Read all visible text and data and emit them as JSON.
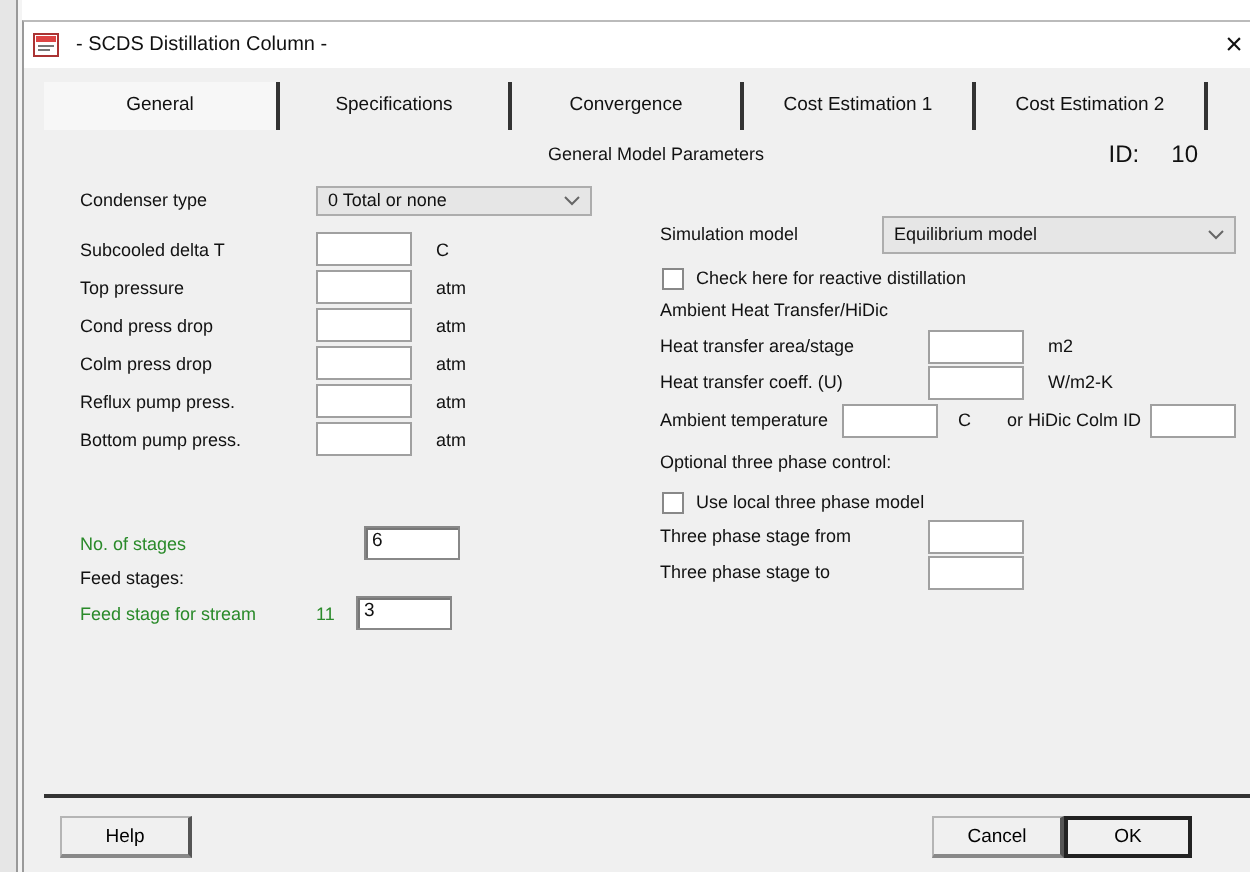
{
  "window": {
    "title": "- SCDS Distillation Column -",
    "close": "×"
  },
  "tabs": [
    {
      "label": "General",
      "selected": true
    },
    {
      "label": "Specifications",
      "selected": false
    },
    {
      "label": "Convergence",
      "selected": false
    },
    {
      "label": "Cost Estimation 1",
      "selected": false
    },
    {
      "label": "Cost Estimation 2",
      "selected": false
    }
  ],
  "panel": {
    "heading": "General Model Parameters",
    "id_label": "ID:",
    "id_value": "10"
  },
  "condenser": {
    "label": "Condenser type",
    "value": "0 Total or none"
  },
  "left_fields": [
    {
      "label": "Subcooled delta T",
      "unit": "C"
    },
    {
      "label": "Top pressure",
      "unit": "atm"
    },
    {
      "label": "Cond press drop",
      "unit": "atm"
    },
    {
      "label": "Colm press drop",
      "unit": "atm"
    },
    {
      "label": "Reflux pump press.",
      "unit": "atm"
    },
    {
      "label": "Bottom pump press.",
      "unit": "atm"
    }
  ],
  "stages": {
    "label": "No. of stages",
    "value": "6"
  },
  "feed": {
    "heading": "Feed stages:",
    "rows": [
      {
        "label": "Feed stage for stream",
        "stream": "11",
        "value": "3"
      }
    ]
  },
  "simulation_model": {
    "label": "Simulation model",
    "value": "Equilibrium model"
  },
  "reactive": {
    "label": "Check here for reactive distillation",
    "checked": false
  },
  "ambient": {
    "heading": "Ambient Heat Transfer/HiDic",
    "rows": [
      {
        "label": "Heat transfer area/stage",
        "unit": "m2"
      },
      {
        "label": "Heat transfer coeff. (U)",
        "unit": "W/m2-K"
      }
    ],
    "temperature": {
      "label": "Ambient temperature",
      "unit": "C",
      "hidic_label": "or HiDic Colm ID"
    }
  },
  "three_phase": {
    "heading": "Optional three phase control:",
    "checkbox": {
      "label": "Use local three phase model",
      "checked": false
    },
    "rows": [
      {
        "label": "Three phase stage from"
      },
      {
        "label": "Three phase stage to"
      }
    ]
  },
  "buttons_left": [
    {
      "label": "Help",
      "default": false
    }
  ],
  "buttons_right": [
    {
      "label": "Cancel",
      "default": false
    },
    {
      "label": "OK",
      "default": true
    }
  ]
}
